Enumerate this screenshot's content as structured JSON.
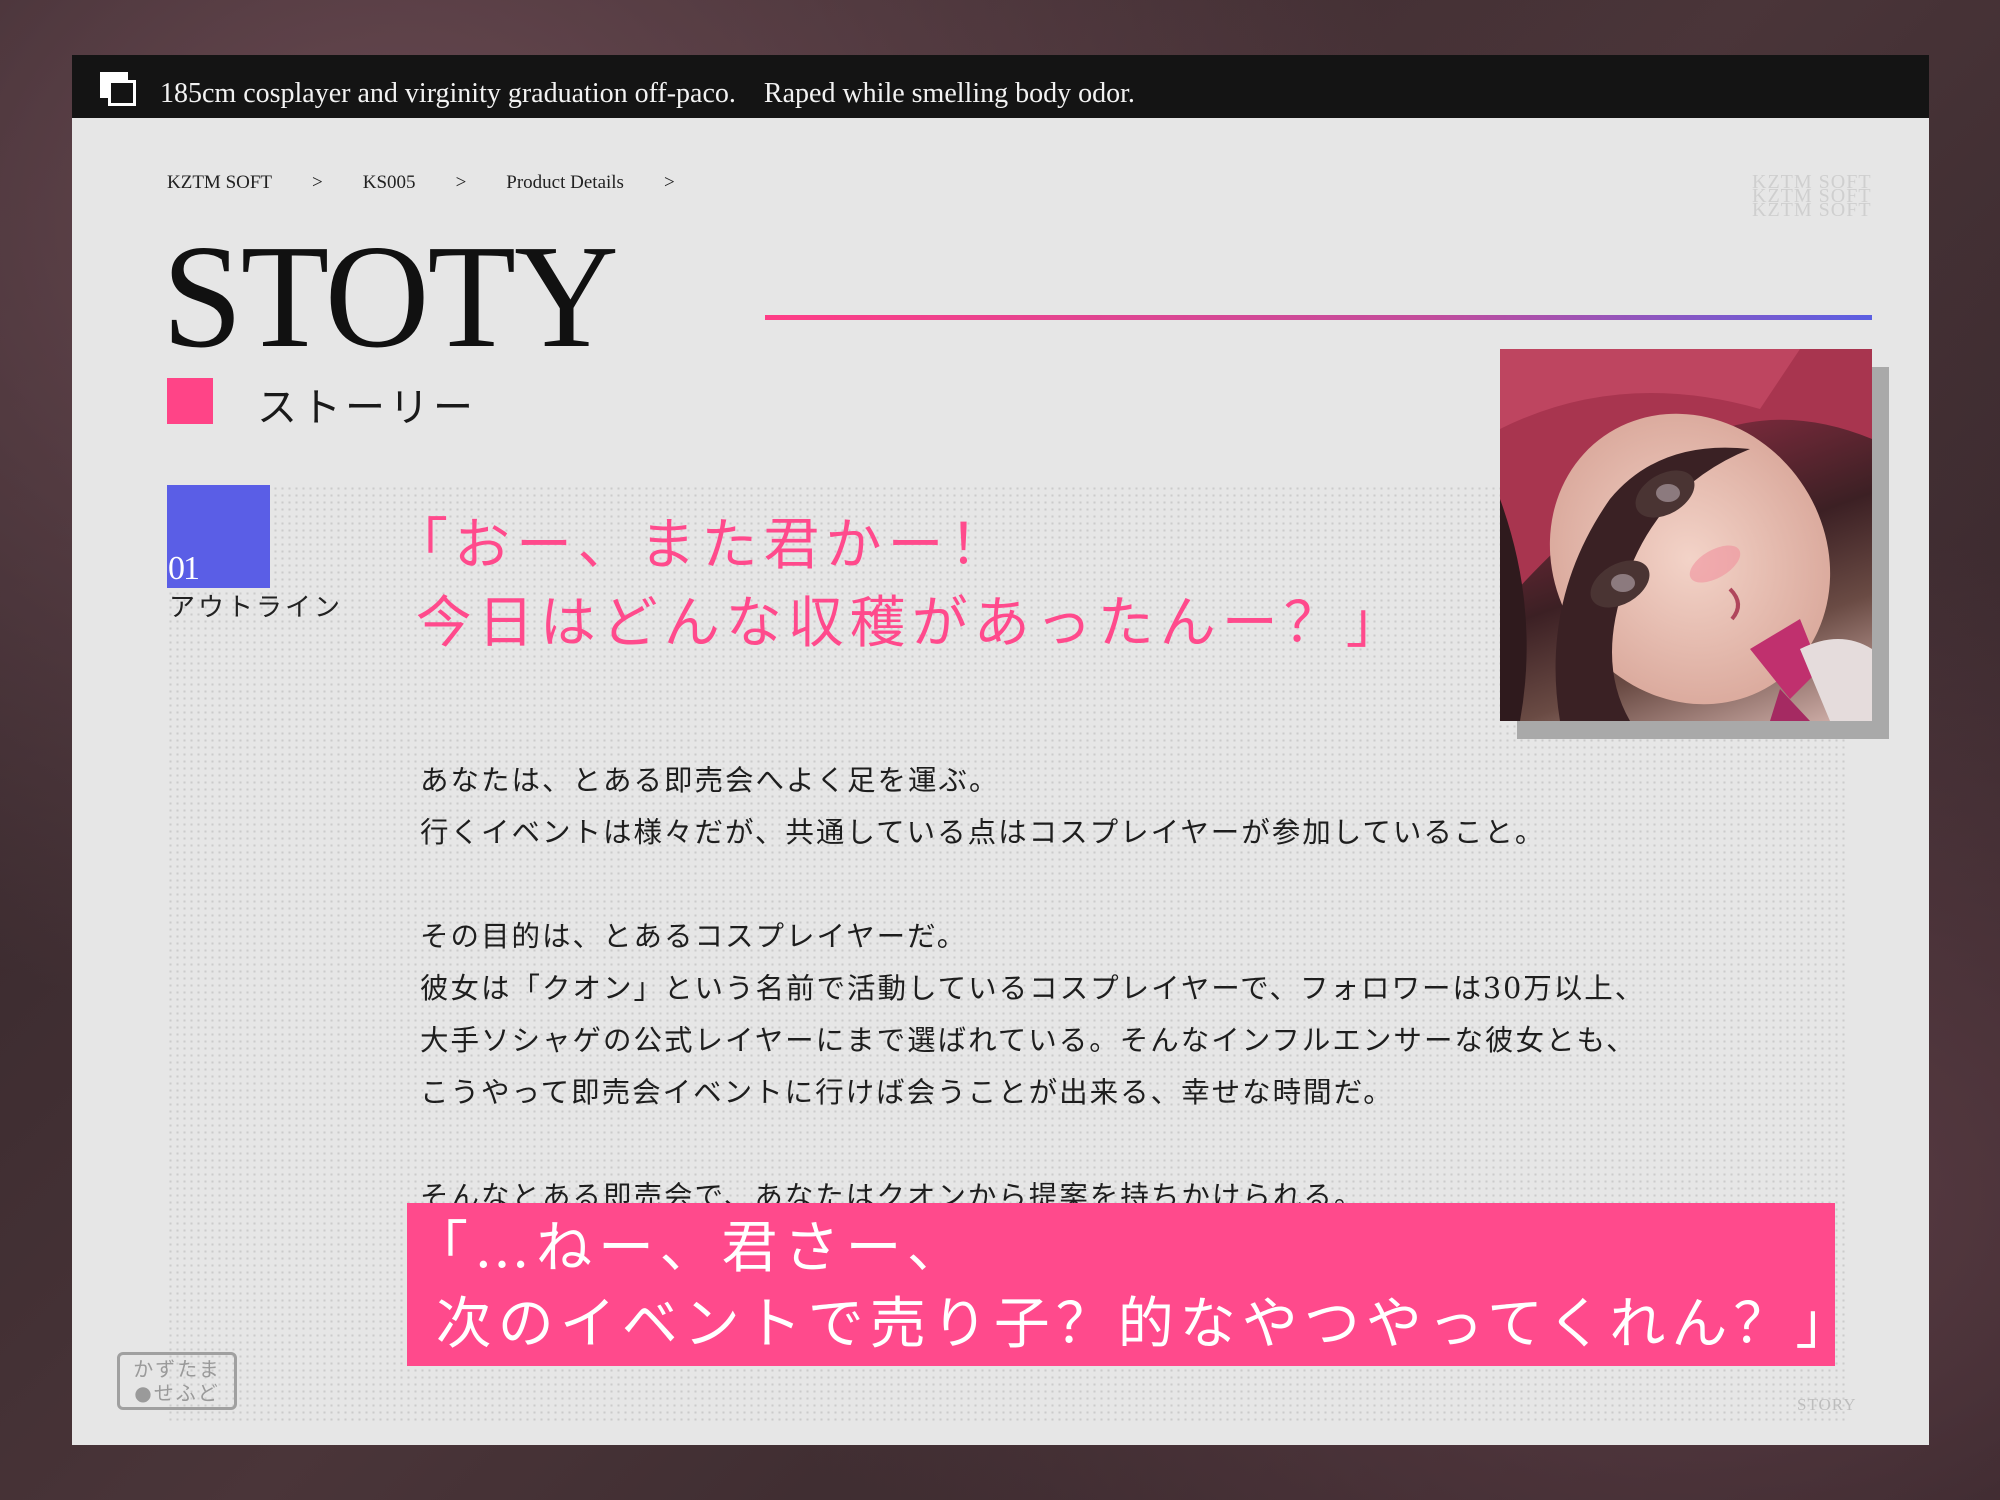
{
  "header": {
    "title": "185cm cosplayer and virginity graduation off-paco.　Raped while smelling body odor."
  },
  "breadcrumb": [
    {
      "label": "KZTM SOFT"
    },
    {
      "label": "KS005"
    },
    {
      "label": "Product Details"
    }
  ],
  "breadcrumb_separator": ">",
  "page_heading": "STOTY",
  "watermark": [
    "KZTM SOFT",
    "KZTM SOFT",
    "KZTM SOFT"
  ],
  "section": {
    "title": "ストーリー",
    "outline_number": "01",
    "outline_label": "アウトライン"
  },
  "quote_top": "「おー、また君かー！\n 今日はどんな収穫があったんー？」",
  "story_body": "あなたは、とある即売会へよく足を運ぶ。\n行くイベントは様々だが、共通している点はコスプレイヤーが参加していること。\n\nその目的は、とあるコスプレイヤーだ。\n彼女は「クオン」という名前で活動しているコスプレイヤーで、フォロワーは30万以上、\n大手ソシャゲの公式レイヤーにまで選ばれている。そんなインフルエンサーな彼女とも、\nこうやって即売会イベントに行けば会うことが出来る、幸せな時間だ。\n\nそんなとある即売会で、あなたはクオンから提案を持ちかけられる。",
  "quote_bottom": "「…ねー、君さー、\n 次のイベントで売り子？的なやつやってくれん？」",
  "logo": {
    "line1": "かずたま",
    "line2": "●せふど"
  },
  "footer_label": "STORY",
  "colors": {
    "accent_pink": "#ff4a8c",
    "accent_blue": "#5a5ee6",
    "panel": "#e6e6e6",
    "topbar": "#141414"
  }
}
